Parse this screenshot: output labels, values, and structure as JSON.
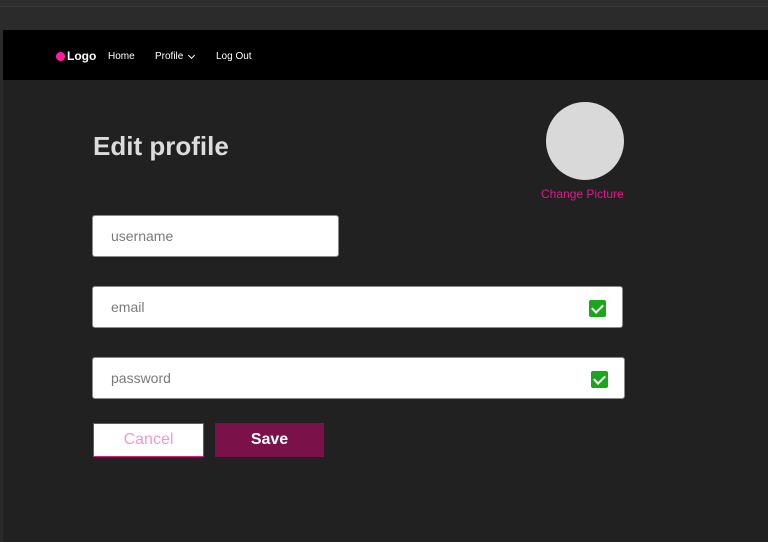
{
  "nav": {
    "logo_text": "Logo",
    "home": "Home",
    "profile": "Profile",
    "logout": "Log Out"
  },
  "page": {
    "title": "Edit profile",
    "change_picture": "Change Picture"
  },
  "form": {
    "username_placeholder": "username",
    "email_placeholder": "email",
    "password_placeholder": "password",
    "email_valid": true,
    "password_valid": true
  },
  "buttons": {
    "cancel": "Cancel",
    "save": "Save"
  },
  "colors": {
    "accent": "#e6148c",
    "save_bg": "#7a1148",
    "check_green": "#1aa81a",
    "canvas_bg": "#212121",
    "navbar_bg": "#000000"
  }
}
